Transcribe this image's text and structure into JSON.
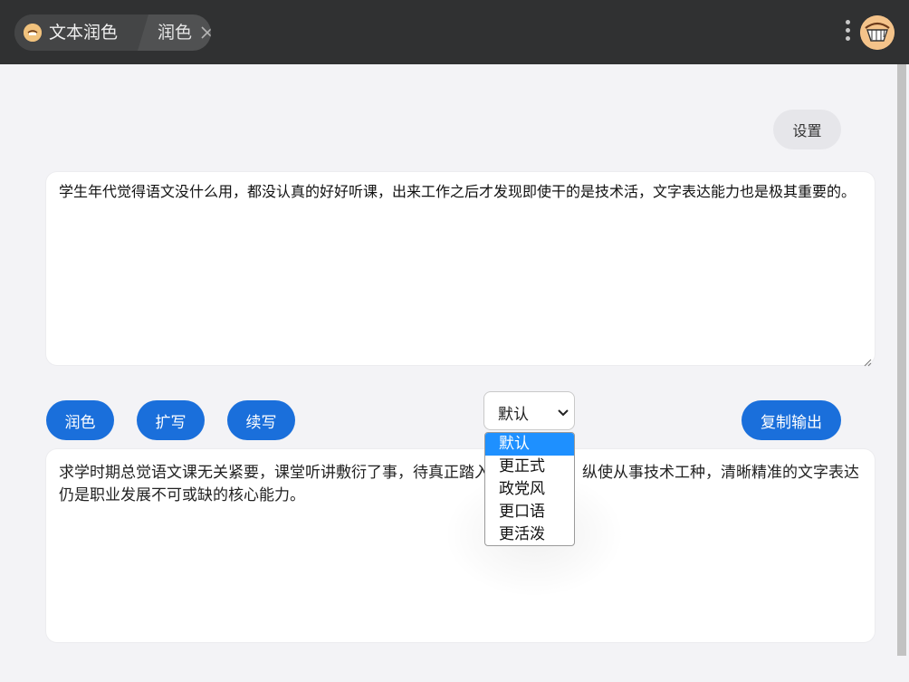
{
  "titlebar": {
    "app_title": "文本润色",
    "tab_label": "润色",
    "colors": {
      "bar": "#303132",
      "crumb": "#444546"
    }
  },
  "settings_label": "设置",
  "input_text": "学生年代觉得语文没什么用，都没认真的好好听课，出来工作之后才发现即使干的是技术活，文字表达能力也是极其重要的。",
  "actions": {
    "polish": "润色",
    "expand": "扩写",
    "continue": "续写",
    "copy_output": "复制输出"
  },
  "style_select": {
    "selected": "默认",
    "options": [
      "默认",
      "更正式",
      "政党风",
      "更口语",
      "更活泼"
    ]
  },
  "output_text": "求学时期总觉语文课无关紧要，课堂听讲敷衍了事，待真正踏入职场后方知，纵使从事技术工种，清晰精准的文字表达仍是职业发展不可或缺的核心能力。",
  "accent_color": "#1a6fdb"
}
